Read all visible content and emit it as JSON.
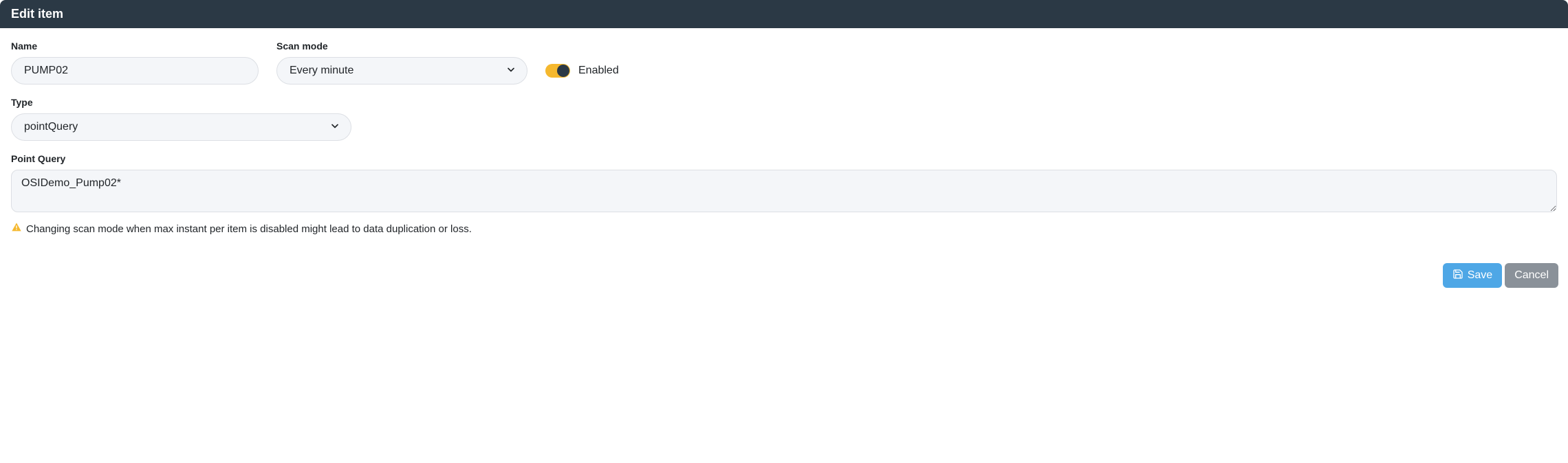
{
  "header": {
    "title": "Edit item"
  },
  "fields": {
    "name": {
      "label": "Name",
      "value": "PUMP02"
    },
    "scan_mode": {
      "label": "Scan mode",
      "value": "Every minute"
    },
    "enabled": {
      "label": "Enabled",
      "value": true
    },
    "type": {
      "label": "Type",
      "value": "pointQuery"
    },
    "point_query": {
      "label": "Point Query",
      "value": "OSIDemo_Pump02*"
    }
  },
  "warning": {
    "text": "Changing scan mode when max instant per item is disabled might lead to data duplication or loss."
  },
  "buttons": {
    "save": "Save",
    "cancel": "Cancel"
  }
}
